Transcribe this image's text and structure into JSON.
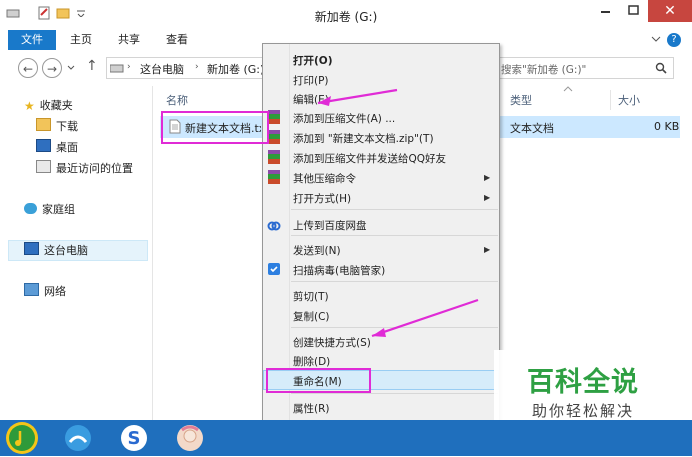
{
  "window": {
    "title": "新加卷 (G:)"
  },
  "ribbon": {
    "tabs": [
      "文件",
      "主页",
      "共享",
      "查看"
    ]
  },
  "address": {
    "path": [
      "这台电脑",
      "新加卷 (G:)"
    ],
    "search_placeholder": "搜索\"新加卷 (G:)\""
  },
  "nav": {
    "favorites": "收藏夹",
    "favorites_items": [
      "下载",
      "桌面",
      "最近访问的位置"
    ],
    "homegroup": "家庭组",
    "this_pc": "这台电脑",
    "network": "网络"
  },
  "columns": {
    "name": "名称",
    "type": "类型",
    "size": "大小"
  },
  "file": {
    "name": "新建文本文档.txt",
    "type": "文本文档",
    "size": "0 KB"
  },
  "context_menu": {
    "open": "打开(O)",
    "print": "打印(P)",
    "edit": "编辑(E)",
    "add_archive": "添加到压缩文件(A) ...",
    "add_zip": "添加到 \"新建文本文档.zip\"(T)",
    "add_send_qq": "添加到压缩文件并发送给QQ好友",
    "other_compress": "其他压缩命令",
    "open_with": "打开方式(H)",
    "upload_baidu": "上传到百度网盘",
    "send_to": "发送到(N)",
    "scan_virus": "扫描病毒(电脑管家)",
    "cut": "剪切(T)",
    "copy": "复制(C)",
    "create_shortcut": "创建快捷方式(S)",
    "delete": "删除(D)",
    "rename": "重命名(M)",
    "properties": "属性(R)"
  },
  "watermark": {
    "title": "百科全说",
    "subtitle": "助你轻松解决"
  },
  "colors": {
    "accent": "#1979ca",
    "annotation": "#e02bd6",
    "watermark_green": "#2ea043",
    "taskbar": "#1f6fbd"
  }
}
